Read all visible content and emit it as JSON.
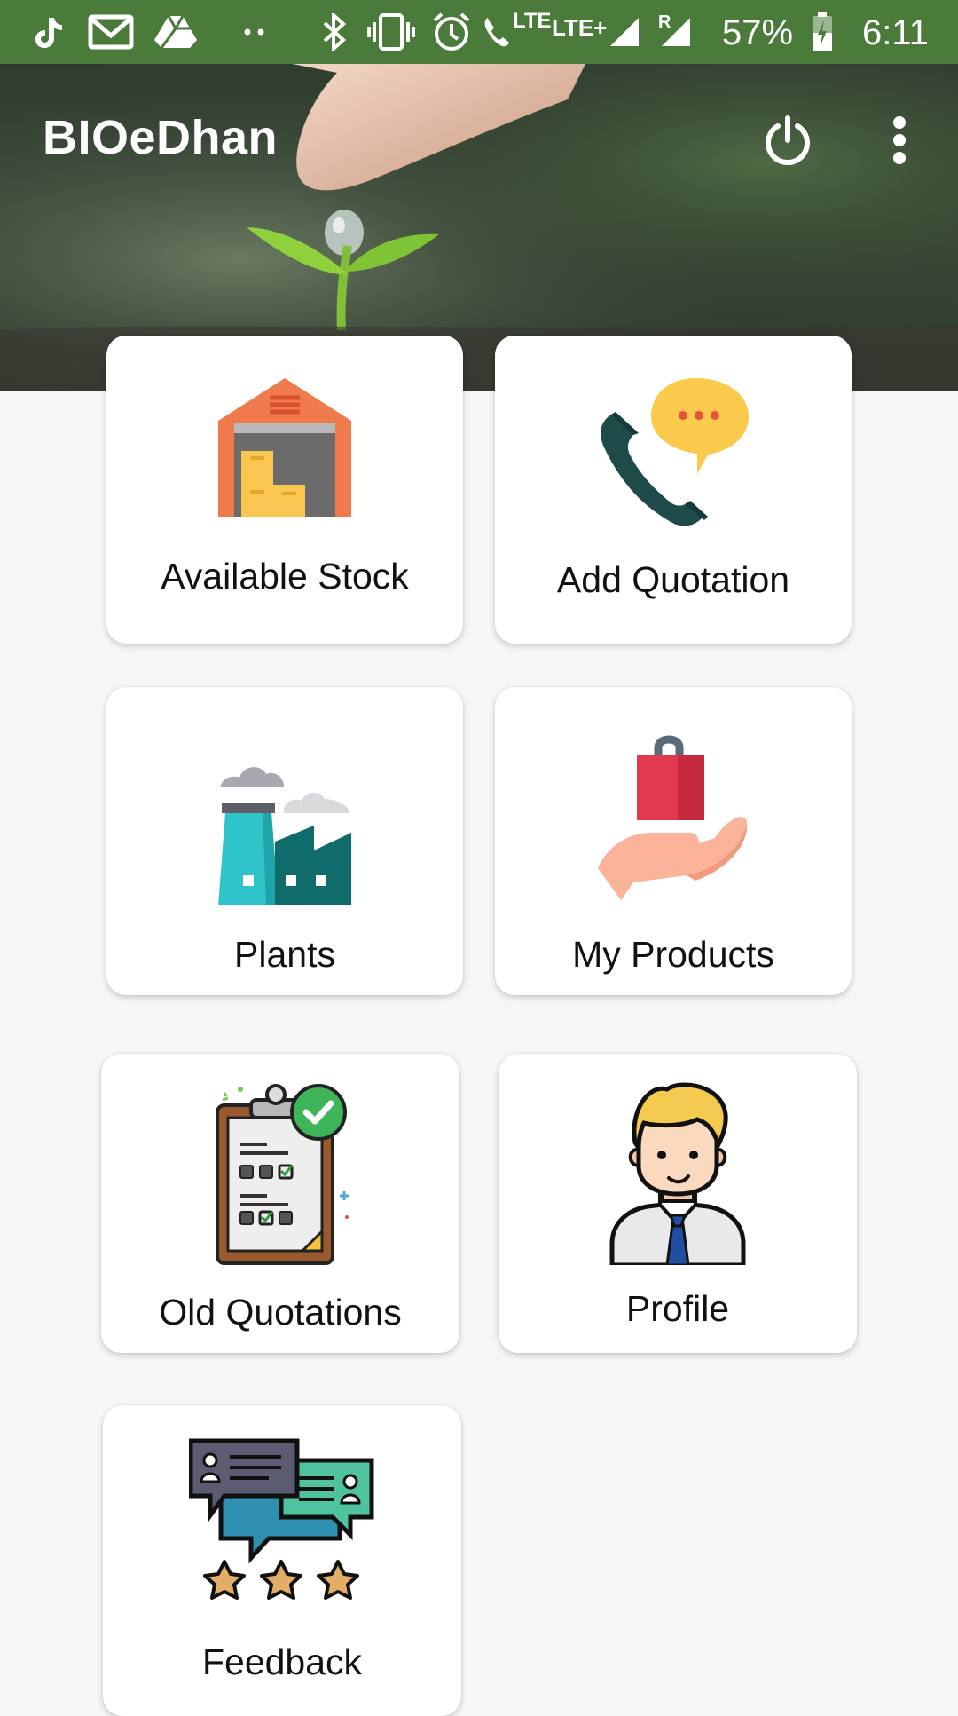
{
  "status_bar": {
    "battery": "57%",
    "time": "6:11",
    "network_1": "LTE",
    "network_2": "LTE+",
    "roaming": "R",
    "icons": [
      "tiktok-icon",
      "gmail-icon",
      "drive-icon",
      "more-notifications-icon",
      "bluetooth-icon",
      "vibrate-icon",
      "alarm-icon",
      "volte-icon",
      "signal-icon",
      "signal-roaming-icon",
      "battery-icon"
    ]
  },
  "header": {
    "title": "BIOeDhan",
    "icons": [
      "power-icon",
      "more-vert-icon"
    ]
  },
  "menu": {
    "items": [
      {
        "label": "Available Stock",
        "icon": "warehouse-icon"
      },
      {
        "label": "Add Quotation",
        "icon": "phone-chat-icon"
      },
      {
        "label": "Plants",
        "icon": "factory-icon"
      },
      {
        "label": "My Products",
        "icon": "hand-bag-icon"
      },
      {
        "label": "Old Quotations",
        "icon": "clipboard-check-icon"
      },
      {
        "label": "Profile",
        "icon": "businessman-icon"
      },
      {
        "label": "Feedback",
        "icon": "feedback-stars-icon"
      }
    ]
  },
  "colors": {
    "status_bar": "#4a7b3a",
    "background": "#f7f7f7",
    "card": "#ffffff"
  }
}
